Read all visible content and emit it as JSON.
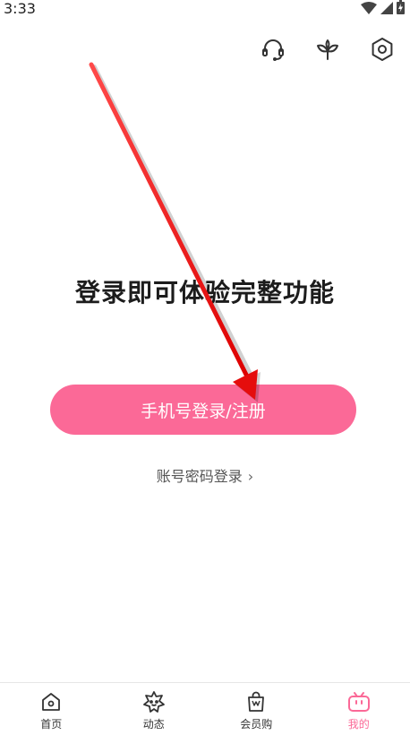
{
  "status_bar": {
    "time": "3:33"
  },
  "top_icons": [
    "headset-icon",
    "sprout-icon",
    "settings-hex-icon"
  ],
  "main": {
    "headline": "登录即可体验完整功能",
    "phone_login_label": "手机号登录/注册",
    "account_login_label": "账号密码登录",
    "account_login_chevron": "›"
  },
  "bottom_nav": {
    "items": [
      {
        "label": "首页",
        "icon": "home-icon"
      },
      {
        "label": "动态",
        "icon": "feed-icon"
      },
      {
        "label": "会员购",
        "icon": "shop-bag-icon"
      },
      {
        "label": "我的",
        "icon": "tv-mine-icon"
      }
    ],
    "active_index": 3
  },
  "colors": {
    "accent": "#fb6997",
    "arrow": "#ee1111"
  }
}
